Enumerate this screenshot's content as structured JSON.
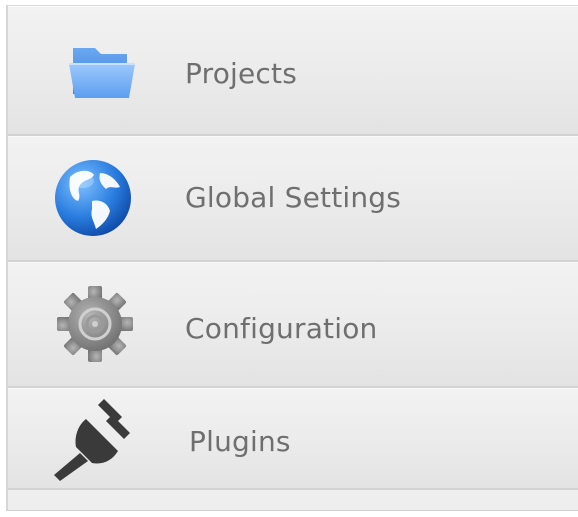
{
  "menu": {
    "items": [
      {
        "label": "Projects",
        "icon": "folder-icon"
      },
      {
        "label": "Global Settings",
        "icon": "globe-icon"
      },
      {
        "label": "Configuration",
        "icon": "gear-icon"
      },
      {
        "label": "Plugins",
        "icon": "plug-icon"
      }
    ]
  },
  "colors": {
    "text": "#6f6f6f",
    "folder": "#5b9ef0",
    "globe": "#1f6fd6",
    "gear": "#8a8a8a",
    "plug": "#3a3a3a"
  }
}
